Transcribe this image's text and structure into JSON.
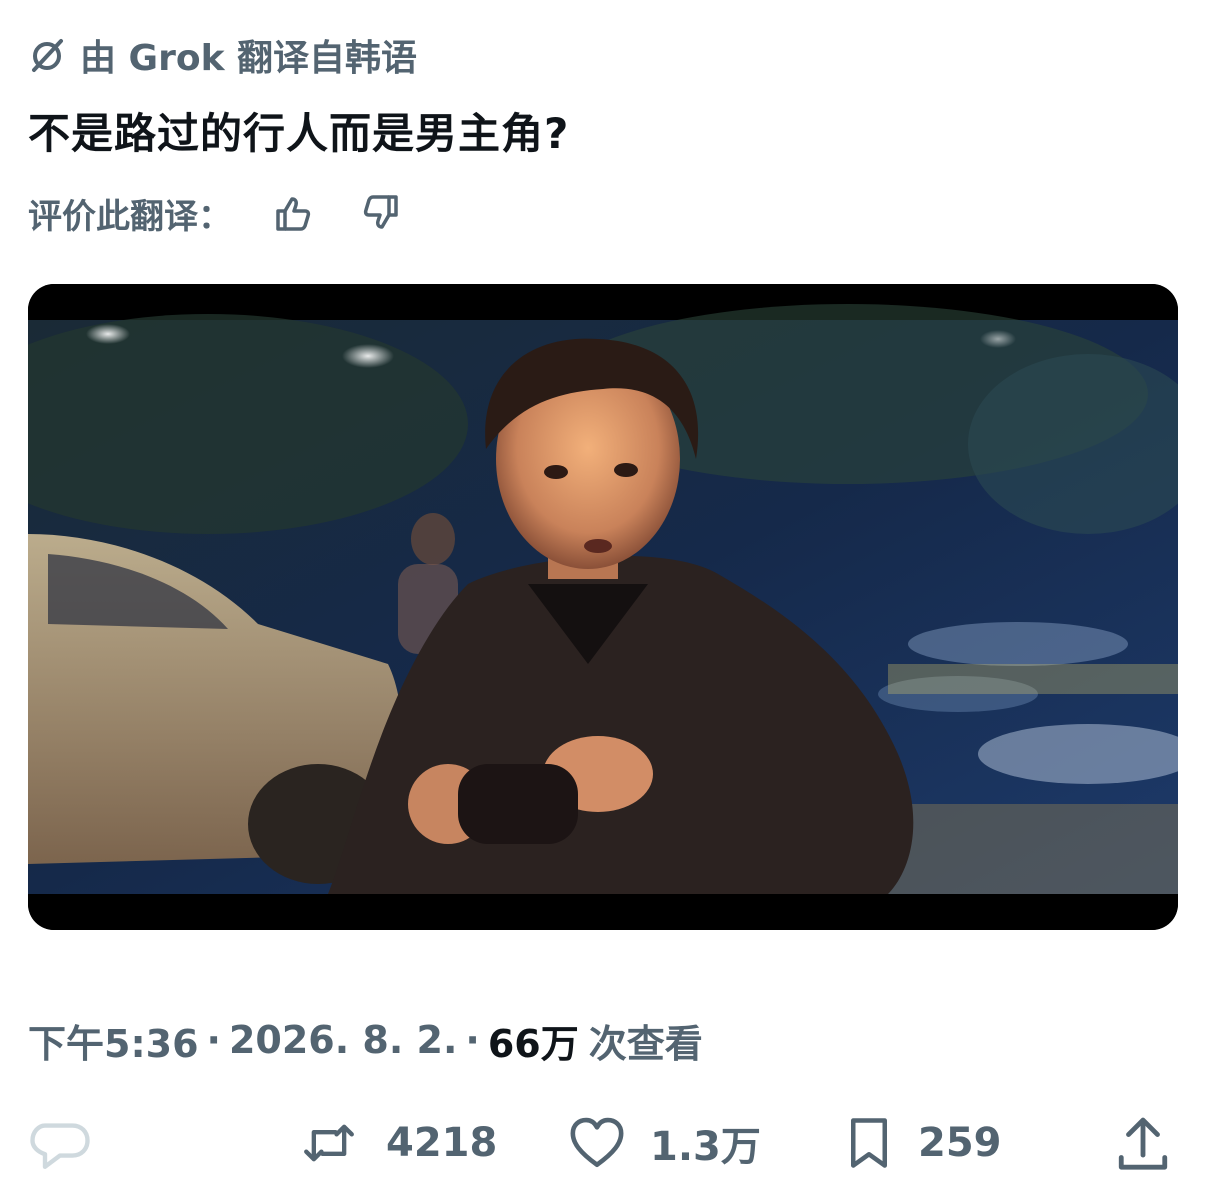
{
  "translation": {
    "icon": "slash-circle-icon",
    "label": "由 Grok 翻译自韩语"
  },
  "post": {
    "text": "不是路过的行人而是男主角?"
  },
  "rating": {
    "label": "评价此翻译：",
    "up_icon": "thumbs-up-icon",
    "down_icon": "thumbs-down-icon"
  },
  "media": {
    "kind": "video-still",
    "description_icon": "video-frame"
  },
  "meta": {
    "time": "下午5:36",
    "date": "2026. 8. 2.",
    "separator": "·",
    "views_count": "66万",
    "views_label": "次查看"
  },
  "actions": {
    "reply_icon": "reply-icon",
    "retweet_count": "4218",
    "like_count": "1.3万",
    "bookmark_count": "259",
    "share_icon": "share-icon"
  },
  "colors": {
    "text_primary": "#0f1419",
    "text_secondary": "#536471",
    "disabled": "#cfd9de"
  }
}
